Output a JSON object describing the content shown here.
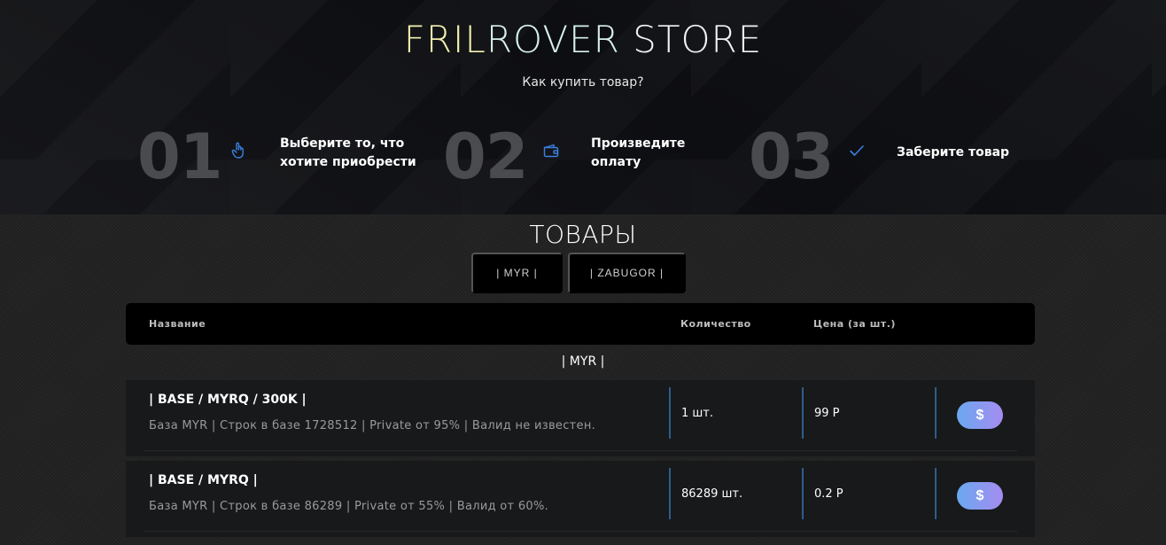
{
  "header": {
    "brand_part1": "FRIL",
    "brand_part2": "ROVER",
    "brand_part3": " STORE",
    "how_to_buy": "Как купить товар?"
  },
  "steps": [
    {
      "number": "01",
      "icon": "hand-pointer-icon",
      "text_line1": "Выберите то, что",
      "text_line2": "хотите приобрести"
    },
    {
      "number": "02",
      "icon": "wallet-icon",
      "text_line1": "Произведите",
      "text_line2": "оплату"
    },
    {
      "number": "03",
      "icon": "checkmark-icon",
      "text_line1": "Заберите товар",
      "text_line2": ""
    }
  ],
  "catalog": {
    "title": "ТОВАРЫ",
    "filters": [
      "| MYR |",
      "| ZABUGOR |"
    ],
    "columns": {
      "name": "Название",
      "quantity": "Количество",
      "price": "Цена (за шт.)"
    },
    "group_label": "| MYR |",
    "items": [
      {
        "name": "| BASE / MYRQ / 300K |",
        "description": "База MYR | Строк в базе 1728512 | Private от 95% | Валид не известен.",
        "quantity": "1 шт.",
        "price": "99 Р",
        "buy_label": "$"
      },
      {
        "name": "| BASE / MYRQ |",
        "description": "База MYR | Строк в базе 86289 | Private от 55% | Валид от 60%.",
        "quantity": "86289 шт.",
        "price": "0.2 Р",
        "buy_label": "$"
      }
    ]
  },
  "colors": {
    "accent_separator": "#2c5d8c",
    "step_icon": "#3b7fe0",
    "buy_gradient_start": "#6aa8f0",
    "buy_gradient_end": "#a58cf0"
  }
}
